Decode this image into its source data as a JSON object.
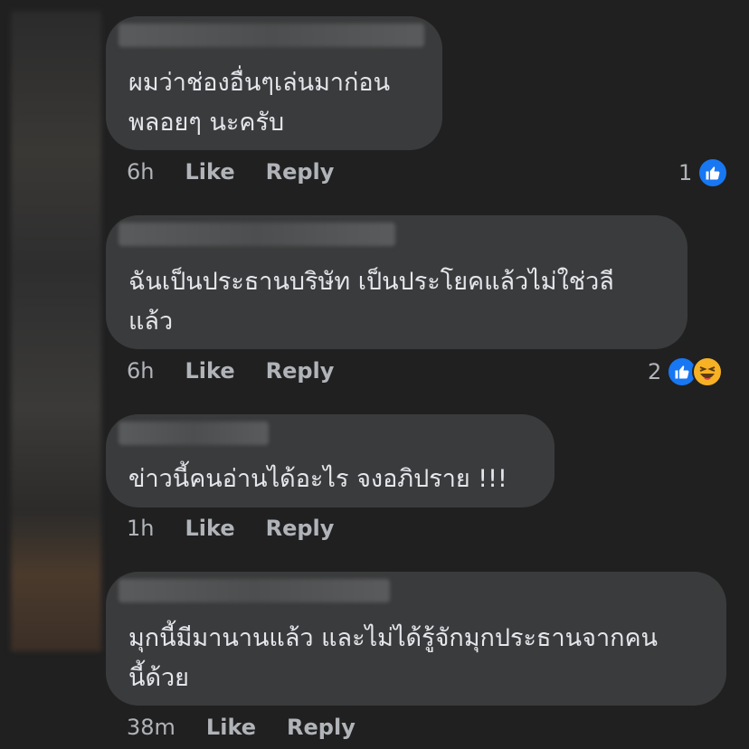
{
  "comments": [
    {
      "text": "ผมว่าช่องอื่นๆเล่นมาก่อน\nพลอยๆ นะครับ",
      "time": "6h",
      "like_label": "Like",
      "reply_label": "Reply",
      "reaction_count": "1",
      "reactions": [
        "like-icon"
      ]
    },
    {
      "text": "ฉันเป็นประธานบริษัท เป็นประโยคแล้วไม่ใช่วลี\nแล้ว",
      "time": "6h",
      "like_label": "Like",
      "reply_label": "Reply",
      "reaction_count": "2",
      "reactions": [
        "like-icon",
        "haha-icon"
      ]
    },
    {
      "text": "ข่าวนี้คนอ่านได้อะไร จงอภิปราย !!!",
      "time": "1h",
      "like_label": "Like",
      "reply_label": "Reply"
    },
    {
      "text": "มุกนี้มีมานานแล้ว และไม่ได้รู้จักมุกประธานจากคน\nนี้ด้วย",
      "time": "38m",
      "like_label": "Like",
      "reply_label": "Reply"
    }
  ],
  "colors": {
    "background": "#202021",
    "bubble": "#3a3b3c",
    "like_blue": "#1877f2",
    "haha_yellow": "#f7b125",
    "meta_text": "#b0b3b8"
  }
}
